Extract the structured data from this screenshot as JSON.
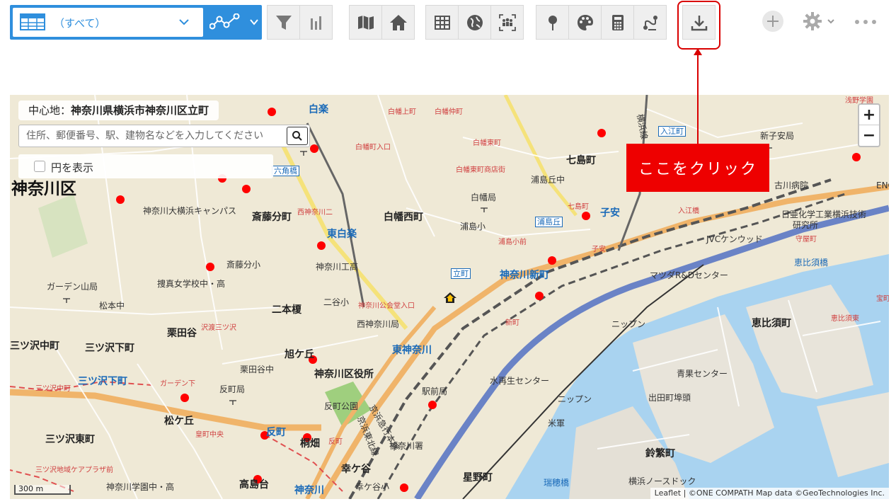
{
  "toolbar": {
    "selector_label": "（すべて）",
    "selector_icon": "table-icon",
    "chart_icon": "line-chart-icon",
    "buttons": [
      {
        "name": "filter-icon"
      },
      {
        "name": "bar-chart-icon"
      },
      {
        "name": "map-icon"
      },
      {
        "name": "home-icon"
      },
      {
        "name": "grid-table-icon"
      },
      {
        "name": "globe-icon"
      },
      {
        "name": "people-icon"
      },
      {
        "name": "pin-icon"
      },
      {
        "name": "palette-icon"
      },
      {
        "name": "calculator-icon"
      },
      {
        "name": "route-icon"
      },
      {
        "name": "download-icon"
      }
    ],
    "right": [
      "plus-icon",
      "gear-icon",
      "more-icon"
    ]
  },
  "map": {
    "center_label": "中心地：",
    "center_value": "神奈川県横浜市神奈川区立町",
    "search_placeholder": "住所、郵便番号、駅、建物名などを入力してください",
    "circle_toggle_label": "円を表示",
    "zoom_in": "+",
    "zoom_out": "−",
    "scale": "300 m",
    "attribution": "Leaflet | ©ONE COMPATH Map data ©GeoTechnologies Inc.",
    "labels": {
      "kanagawa_ku": "神奈川区",
      "hakuraku": "白楽",
      "higashi_hakuraku": "東白楽",
      "rokkakubashi": "六角橋",
      "saitobuncho": "斎藤分町",
      "hakuba_nishimachi": "白幡西町",
      "nanashimacho": "七島町",
      "koyasu": "子安",
      "urashimaoka": "浦島丘",
      "tatemachi": "立町",
      "kanagawa_shinmachi": "神奈川新町",
      "nichome": "二本榎",
      "tadaya": "栗田谷",
      "asahigaoka": "旭ケ丘",
      "higashi_kanagawa": "東神奈川",
      "kanagawa_kuyakusho": "神奈川区役所",
      "tanmachi_park": "反町公園",
      "tanmachi": "反町",
      "kiribata": "桐畑",
      "kokagaya": "幸ケ谷",
      "hoshinomachi": "星野町",
      "takashimadai": "高島台",
      "kanagawa": "神奈川",
      "matsugaoka": "松ケ丘",
      "mitsuzawa_nakamachi": "三ツ沢中町",
      "mitsuzawa_shimomachi": "三ツ沢下町",
      "mitsuzawa_shimomachi_st": "三ツ沢下町",
      "mitsuzawa_higashimachi": "三ツ沢東町",
      "ebisucho": "恵比須町",
      "suzushigecho": "鈴繁町",
      "irie_cho": "入江町",
      "shinkoyasu": "新子安局",
      "furukawa_hosp": "古川病院",
      "nichia": "日亜化学工業横浜技術",
      "kenkyusho": "研究所",
      "jvc": "JVCケンウッド",
      "mazda": "マツダR&Dセンター",
      "nippun": "ニップン",
      "nippun2": "ニップン",
      "seika": "青果センター",
      "idemachi": "出田町埠頭",
      "mizusaisei": "水再生センター",
      "beigun": "米軍",
      "north_dock": "横浜ノースドック",
      "mizuhobashi": "瑞穂橋",
      "ebisubashi": "恵比須橋",
      "ookuchi": "大横キャンパス",
      "kanagawa_daiyoko": "神奈川大横浜キャンパス",
      "saitobuncho_es": "斎藤分小",
      "sotai": "捜真女学校中・高",
      "garden": "ガーデン山局",
      "matsumotochu": "松本中",
      "kuritadaya_chu": "栗田谷中",
      "tanmachi_kyoku": "反町局",
      "nishi_kanagawa": "西神奈川局",
      "kanagawa_kogo": "神奈川工高",
      "niya": "二谷小",
      "hakuba_kyoku": "白幡局",
      "urashima_sho": "浦島小",
      "urashimaoka_chu": "浦島丘中",
      "kanagawa_gakuen": "神奈川学園中・高",
      "kanagawa_sho": "神奈川署",
      "ekimae": "駅前局",
      "kokagaya_sho": "幸ケ谷小",
      "keihin_kyuko": "京浜急行本線",
      "keihin_tohoku": "京浜東北線",
      "yokohama_line": "横浜線",
      "hakuba_kamicho": "白幡上町",
      "hakuba_nakacho": "白幡仲町",
      "hakuba_higashicho": "白幡東町",
      "hakuba_iriguchi": "白幡町入口",
      "hakuba_shotengai": "白幡東町商店街",
      "nishi_kanagawa2": "西神奈川二",
      "urashimakomachi": "浦島小前",
      "kanagawa_kokaido": "神奈川公会堂入口",
      "shinmachi": "新町",
      "nanashima": "七島町",
      "koyasu_red": "子安",
      "irie": "入江橋",
      "sankai": "三ツ沢地域ケアプラザ前",
      "mitsuzawa_chu": "三ツ沢中町",
      "garden2": "ガーデン下",
      "kozawa": "沢渡三ツ沢",
      "tanmachi_red": "反町",
      "koganecho": "皇町中央",
      "asano": "浅野学園",
      "eng": "ENG",
      "moriya": "守屋町",
      "ebisu_higashi": "恵比須東",
      "takara": "宝町"
    }
  },
  "callout": "ここをクリック",
  "colors": {
    "accent": "#2f8fdd",
    "callout": "#ee0000",
    "marker": "#ff0000",
    "water": "#a9d3f0",
    "road_major": "#f5b86b",
    "road_blue": "#6a83c6"
  }
}
